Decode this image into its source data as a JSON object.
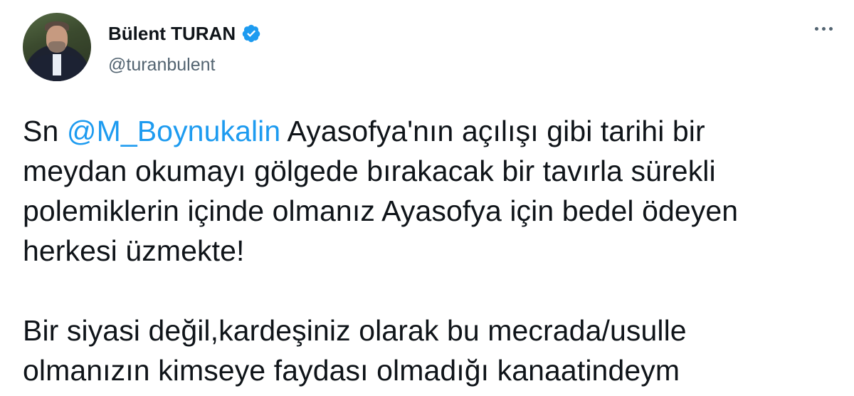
{
  "author": {
    "display_name": "Bülent TURAN",
    "handle": "@turanbulent",
    "verified": true,
    "avatar_icon": "profile-photo"
  },
  "more_icon": "ellipsis-icon",
  "tweet": {
    "p1_lines": [
      {
        "prefix": "Sn ",
        "mention": "@M_Boynukalin",
        "rest": " Ayasofya'nın açılışı gibi tarihi bir"
      },
      {
        "text": "meydan okumayı gölgede bırakacak bir tavırla sürekli"
      },
      {
        "text": "polemiklerin içinde olmanız Ayasofya için bedel ödeyen"
      },
      {
        "text": "herkesi üzmekte!"
      }
    ],
    "p2_lines": [
      {
        "text": "Bir siyasi değil,kardeşiniz olarak bu mecrada/usulle"
      },
      {
        "text": "olmanızın kimseye faydası olmadığı kanaatindeym"
      }
    ]
  },
  "colors": {
    "text": "#0f1419",
    "secondary": "#536471",
    "link": "#1d9bf0",
    "verified": "#1d9bf0"
  }
}
